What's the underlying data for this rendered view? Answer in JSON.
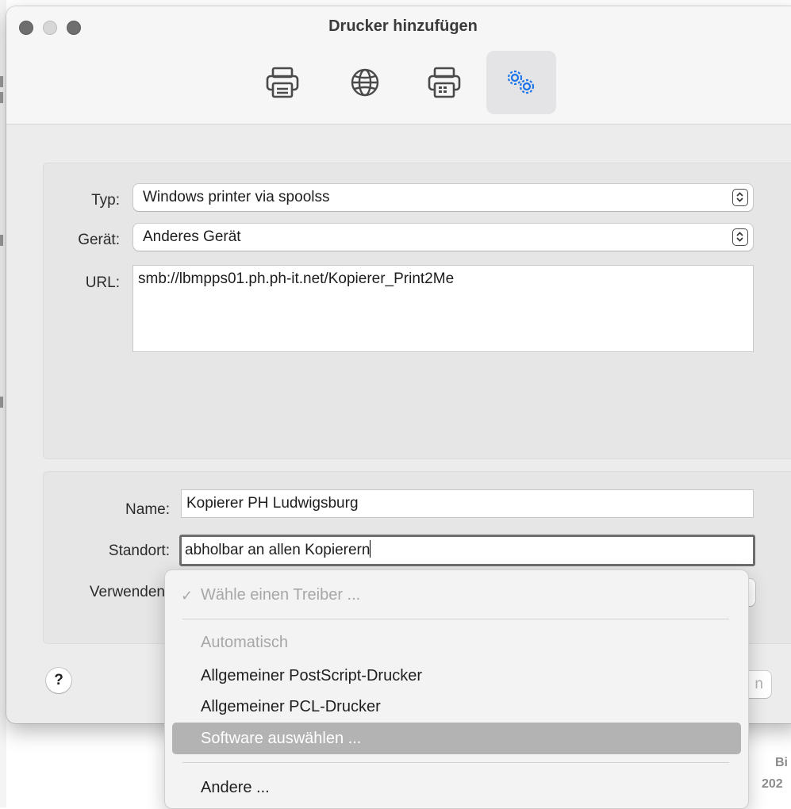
{
  "window": {
    "title": "Drucker hinzufügen"
  },
  "toolbar": {
    "items": [
      {
        "icon": "printer-icon"
      },
      {
        "icon": "globe-icon"
      },
      {
        "icon": "fax-printer-icon"
      },
      {
        "icon": "gears-icon",
        "active": true
      }
    ]
  },
  "connection": {
    "type_label": "Typ:",
    "type_value": "Windows printer via spoolss",
    "device_label": "Gerät:",
    "device_value": "Anderes Gerät",
    "url_label": "URL:",
    "url_value": "smb://lbmpps01.ph.ph-it.net/Kopierer_Print2Me"
  },
  "details": {
    "name_label": "Name:",
    "name_value": "Kopierer PH Ludwigsburg",
    "location_label": "Standort:",
    "location_value": "abholbar an allen Kopierern",
    "use_label": "Verwenden"
  },
  "footer": {
    "help_label": "?",
    "right_button_partial": "n"
  },
  "driver_menu": {
    "selected": "Wähle einen Treiber ...",
    "check": "✓",
    "items": [
      {
        "label": "Automatisch",
        "disabled": true
      },
      {
        "label": "Allgemeiner PostScript-Drucker"
      },
      {
        "label": "Allgemeiner PCL-Drucker"
      },
      {
        "label": "Software auswählen ...",
        "highlighted": true
      },
      {
        "label": "Andere ..."
      }
    ]
  },
  "background": {
    "line1": "Bi",
    "line2": "202"
  }
}
